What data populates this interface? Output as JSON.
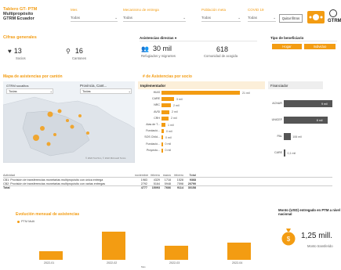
{
  "header": {
    "title_line1": "Tablero GT- PTM",
    "title_line2": "Multipropósito",
    "title_line3": "GTRM Ecuador",
    "quitar_filtros": "Quitar filtros",
    "logo_text": "GTRM"
  },
  "filters": [
    {
      "label": "Mes",
      "value": "Todas"
    },
    {
      "label": "Mecanismo de entrega",
      "value": "Todas"
    },
    {
      "label": "Población meta",
      "value": "Todas"
    },
    {
      "label": "COVID 19",
      "value": "Todas"
    }
  ],
  "cifras": {
    "heading": "Cifras generales",
    "socios_value": "13",
    "socios_label": "Socios",
    "cantones_value": "16",
    "cantones_label": "Cantones"
  },
  "asistencias": {
    "title": "Asistencias directas ●",
    "main_value": "30 mil",
    "main_label": "Refugiados y migrantes",
    "second_value": "618",
    "second_label": "Comunidad de acogida"
  },
  "beneficiario": {
    "title": "Tipo de beneficiario",
    "buttons": [
      "Hogar",
      "Individuo"
    ]
  },
  "map": {
    "heading": "Mapa de asistencias por cantón",
    "filter1_label": "GTRM socalitos",
    "filter1_value": "Todas",
    "filter2_label": "Provincia, Cant...",
    "filter2_value": "Todas",
    "credit": "© 2022 TomTom, © 2022 Microsoft Terms"
  },
  "implementador": {
    "heading": "# de Asistencias por socio",
    "title": "Implementador",
    "rows": [
      {
        "label": "HIAS",
        "value": "21 mil",
        "frac": 1.0
      },
      {
        "label": "CARE",
        "value": "3 mil",
        "frac": 0.16
      },
      {
        "label": "NRC",
        "value": "2 mil",
        "frac": 0.12
      },
      {
        "label": "AVSI",
        "value": "2 mil",
        "frac": 0.1
      },
      {
        "label": "CRH",
        "value": "2 mil",
        "frac": 0.09
      },
      {
        "label": "Alas de T...",
        "value": "1 mil",
        "frac": 0.05
      },
      {
        "label": "Fundació...",
        "value": "0 mil",
        "frac": 0.03
      },
      {
        "label": "SOS Child...",
        "value": "0 mil",
        "frac": 0.02
      },
      {
        "label": "Fundació...",
        "value": "0 mil",
        "frac": 0.015
      },
      {
        "label": "Proyecto...",
        "value": "0 mil",
        "frac": 0.01
      }
    ]
  },
  "financiador": {
    "title": "Financiador",
    "rows": [
      {
        "label": "ACNUR",
        "value": "9 mil",
        "frac": 1.0
      },
      {
        "label": "UNICEF",
        "value": "8 mil",
        "frac": 0.9
      },
      {
        "label": "PAL",
        "value": "106 mil",
        "frac": 0.15
      },
      {
        "label": "CARE",
        "value": "0,1 mil",
        "frac": 0.04
      }
    ]
  },
  "table": {
    "headers": [
      "Actividad",
      "noviembre",
      "febrero",
      "marzo",
      "febrero",
      "Total"
    ],
    "rows": [
      [
        "CB1: Provisión de transferencias monetarias multipropósito con única entrega",
        "1983",
        "4329",
        "1718",
        "1528",
        "9368"
      ],
      [
        "CB2: Provisión de transferencias monetarias multipropósito con varias entregas",
        "2792",
        "5164",
        "5948",
        "7598",
        "20790"
      ],
      [
        "Total",
        "4777",
        "15093",
        "7666",
        "9114",
        "30158"
      ]
    ]
  },
  "evolucion": {
    "heading": "Evolución mensual de asistencias",
    "legend": "PTM Multi",
    "x_label": "Mes"
  },
  "chart_data": {
    "type": "bar",
    "categories": [
      "2022-01",
      "2022-02",
      "2022-03",
      "2022-04"
    ],
    "series": [
      {
        "name": "PTM Multi",
        "values": [
          4777,
          15093,
          7666,
          9114
        ]
      }
    ],
    "title": "Evolución mensual de asistencias",
    "xlabel": "Mes",
    "ylabel": ""
  },
  "monto": {
    "title": "Monto (USD) entregado en PTM a nivel nacional",
    "value": "1,25 mill.",
    "label": "Monto transferido"
  }
}
